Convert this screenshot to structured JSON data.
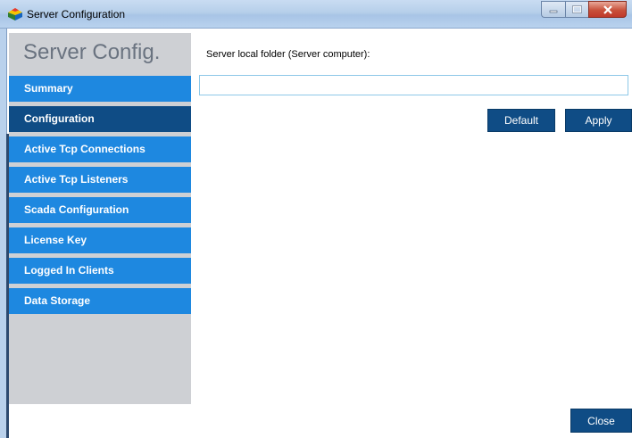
{
  "window": {
    "title": "Server Configuration"
  },
  "sidebar": {
    "heading": "Server Config.",
    "items": [
      {
        "label": "Summary",
        "active": false
      },
      {
        "label": "Configuration",
        "active": true
      },
      {
        "label": "Active Tcp Connections",
        "active": false
      },
      {
        "label": "Active Tcp Listeners",
        "active": false
      },
      {
        "label": "Scada Configuration",
        "active": false
      },
      {
        "label": "License Key",
        "active": false
      },
      {
        "label": "Logged In Clients",
        "active": false
      },
      {
        "label": "Data Storage",
        "active": false
      }
    ]
  },
  "main": {
    "folder_label": "Server local folder (Server computer):",
    "folder_value": "",
    "default_label": "Default",
    "apply_label": "Apply",
    "close_label": "Close"
  },
  "colors": {
    "nav_item": "#1e88e0",
    "nav_item_active": "#0f4c85",
    "button": "#0f4c85",
    "sidebar_bg": "#ced0d4"
  }
}
